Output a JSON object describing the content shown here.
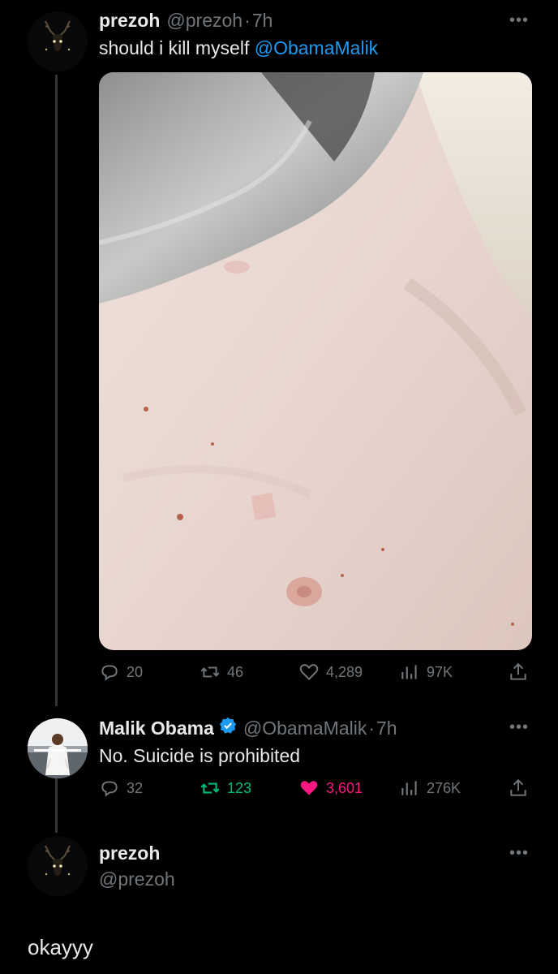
{
  "tweet1": {
    "name": "prezoh",
    "handle": "@prezoh",
    "dot": "·",
    "time": "7h",
    "text": "should i kill myself ",
    "mention": "@ObamaMalik",
    "more": "•••",
    "stats": {
      "replies": "20",
      "retweets": "46",
      "likes": "4,289",
      "views": "97K"
    }
  },
  "tweet2": {
    "name": "Malik Obama",
    "handle": "@ObamaMalik",
    "dot": "·",
    "time": "7h",
    "text": "No. Suicide is prohibited",
    "more": "•••",
    "stats": {
      "replies": "32",
      "retweets": "123",
      "likes": "3,601",
      "views": "276K"
    }
  },
  "tweet3": {
    "name": "prezoh",
    "handle": "@prezoh",
    "more": "•••",
    "text": "okayyy"
  },
  "colors": {
    "accent": "#1d9bf0",
    "retweet": "#00ba7c",
    "like": "#f91880",
    "muted": "#71767b"
  },
  "icons": [
    "reply-icon",
    "retweet-icon",
    "heart-icon",
    "views-icon",
    "share-icon",
    "verified-badge-icon",
    "more-icon"
  ]
}
